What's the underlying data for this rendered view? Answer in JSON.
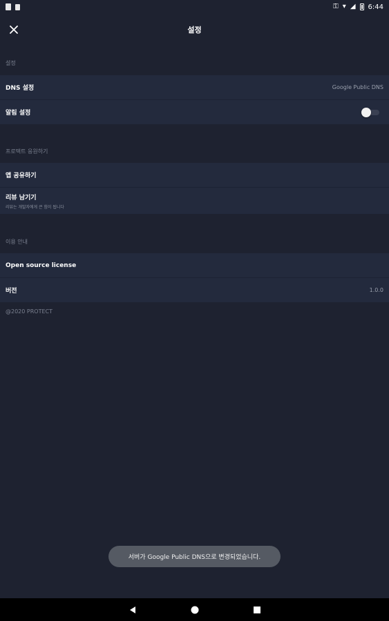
{
  "status_bar": {
    "time": "6:44"
  },
  "header": {
    "title": "설정"
  },
  "sections": {
    "settings": {
      "title": "설정",
      "dns_label": "DNS 설정",
      "dns_value": "Google Public DNS",
      "notification_label": "알림 설정",
      "notification_enabled": false
    },
    "support": {
      "title": "프로텍트 응원하기",
      "share_label": "앱 공유하기",
      "review_label": "리뷰 남기기",
      "review_sub": "리뷰는 개발자에게 큰 힘이 됩니다"
    },
    "usage": {
      "title": "이용 안내",
      "license_label": "Open source license",
      "version_label": "버전",
      "version_value": "1.0.0"
    }
  },
  "footer": {
    "copyright": "@2020 PROTECT"
  },
  "toast": {
    "message": "서버가 Google Public DNS으로 변경되었습니다."
  },
  "colors": {
    "background": "#1e2230",
    "row_background": "#232a3d",
    "section_text": "#7b8190",
    "toast_background": "#555a63"
  }
}
